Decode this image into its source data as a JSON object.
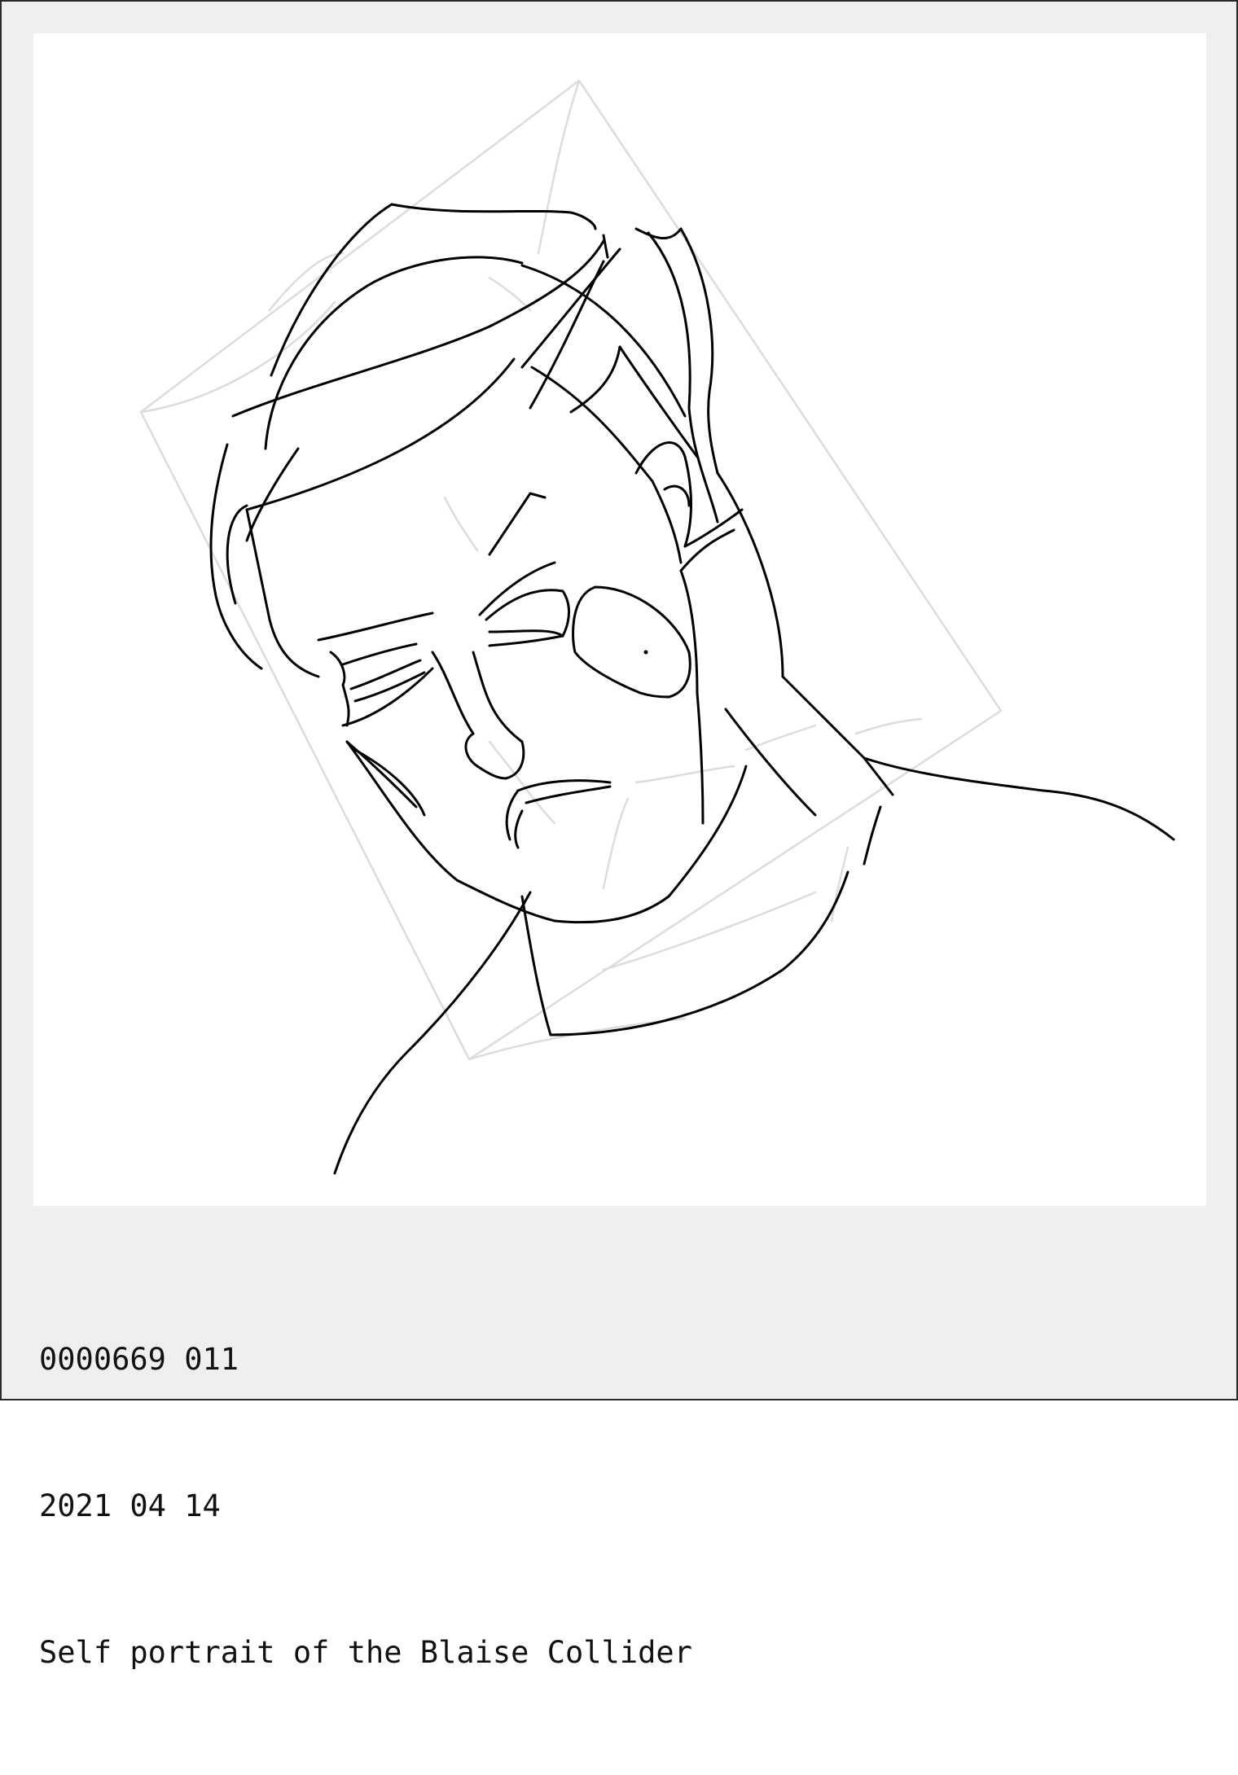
{
  "artwork": {
    "subject_icon": "line-drawing-portrait",
    "stroke_color": "#000000",
    "guide_color": "#dcdcdc",
    "frame_color": "#efefef",
    "canvas_color": "#ffffff"
  },
  "caption": {
    "id_line": "0000669 011",
    "date_line": "2021 04 14",
    "title_line": "Self portrait of the Blaise Collider"
  }
}
